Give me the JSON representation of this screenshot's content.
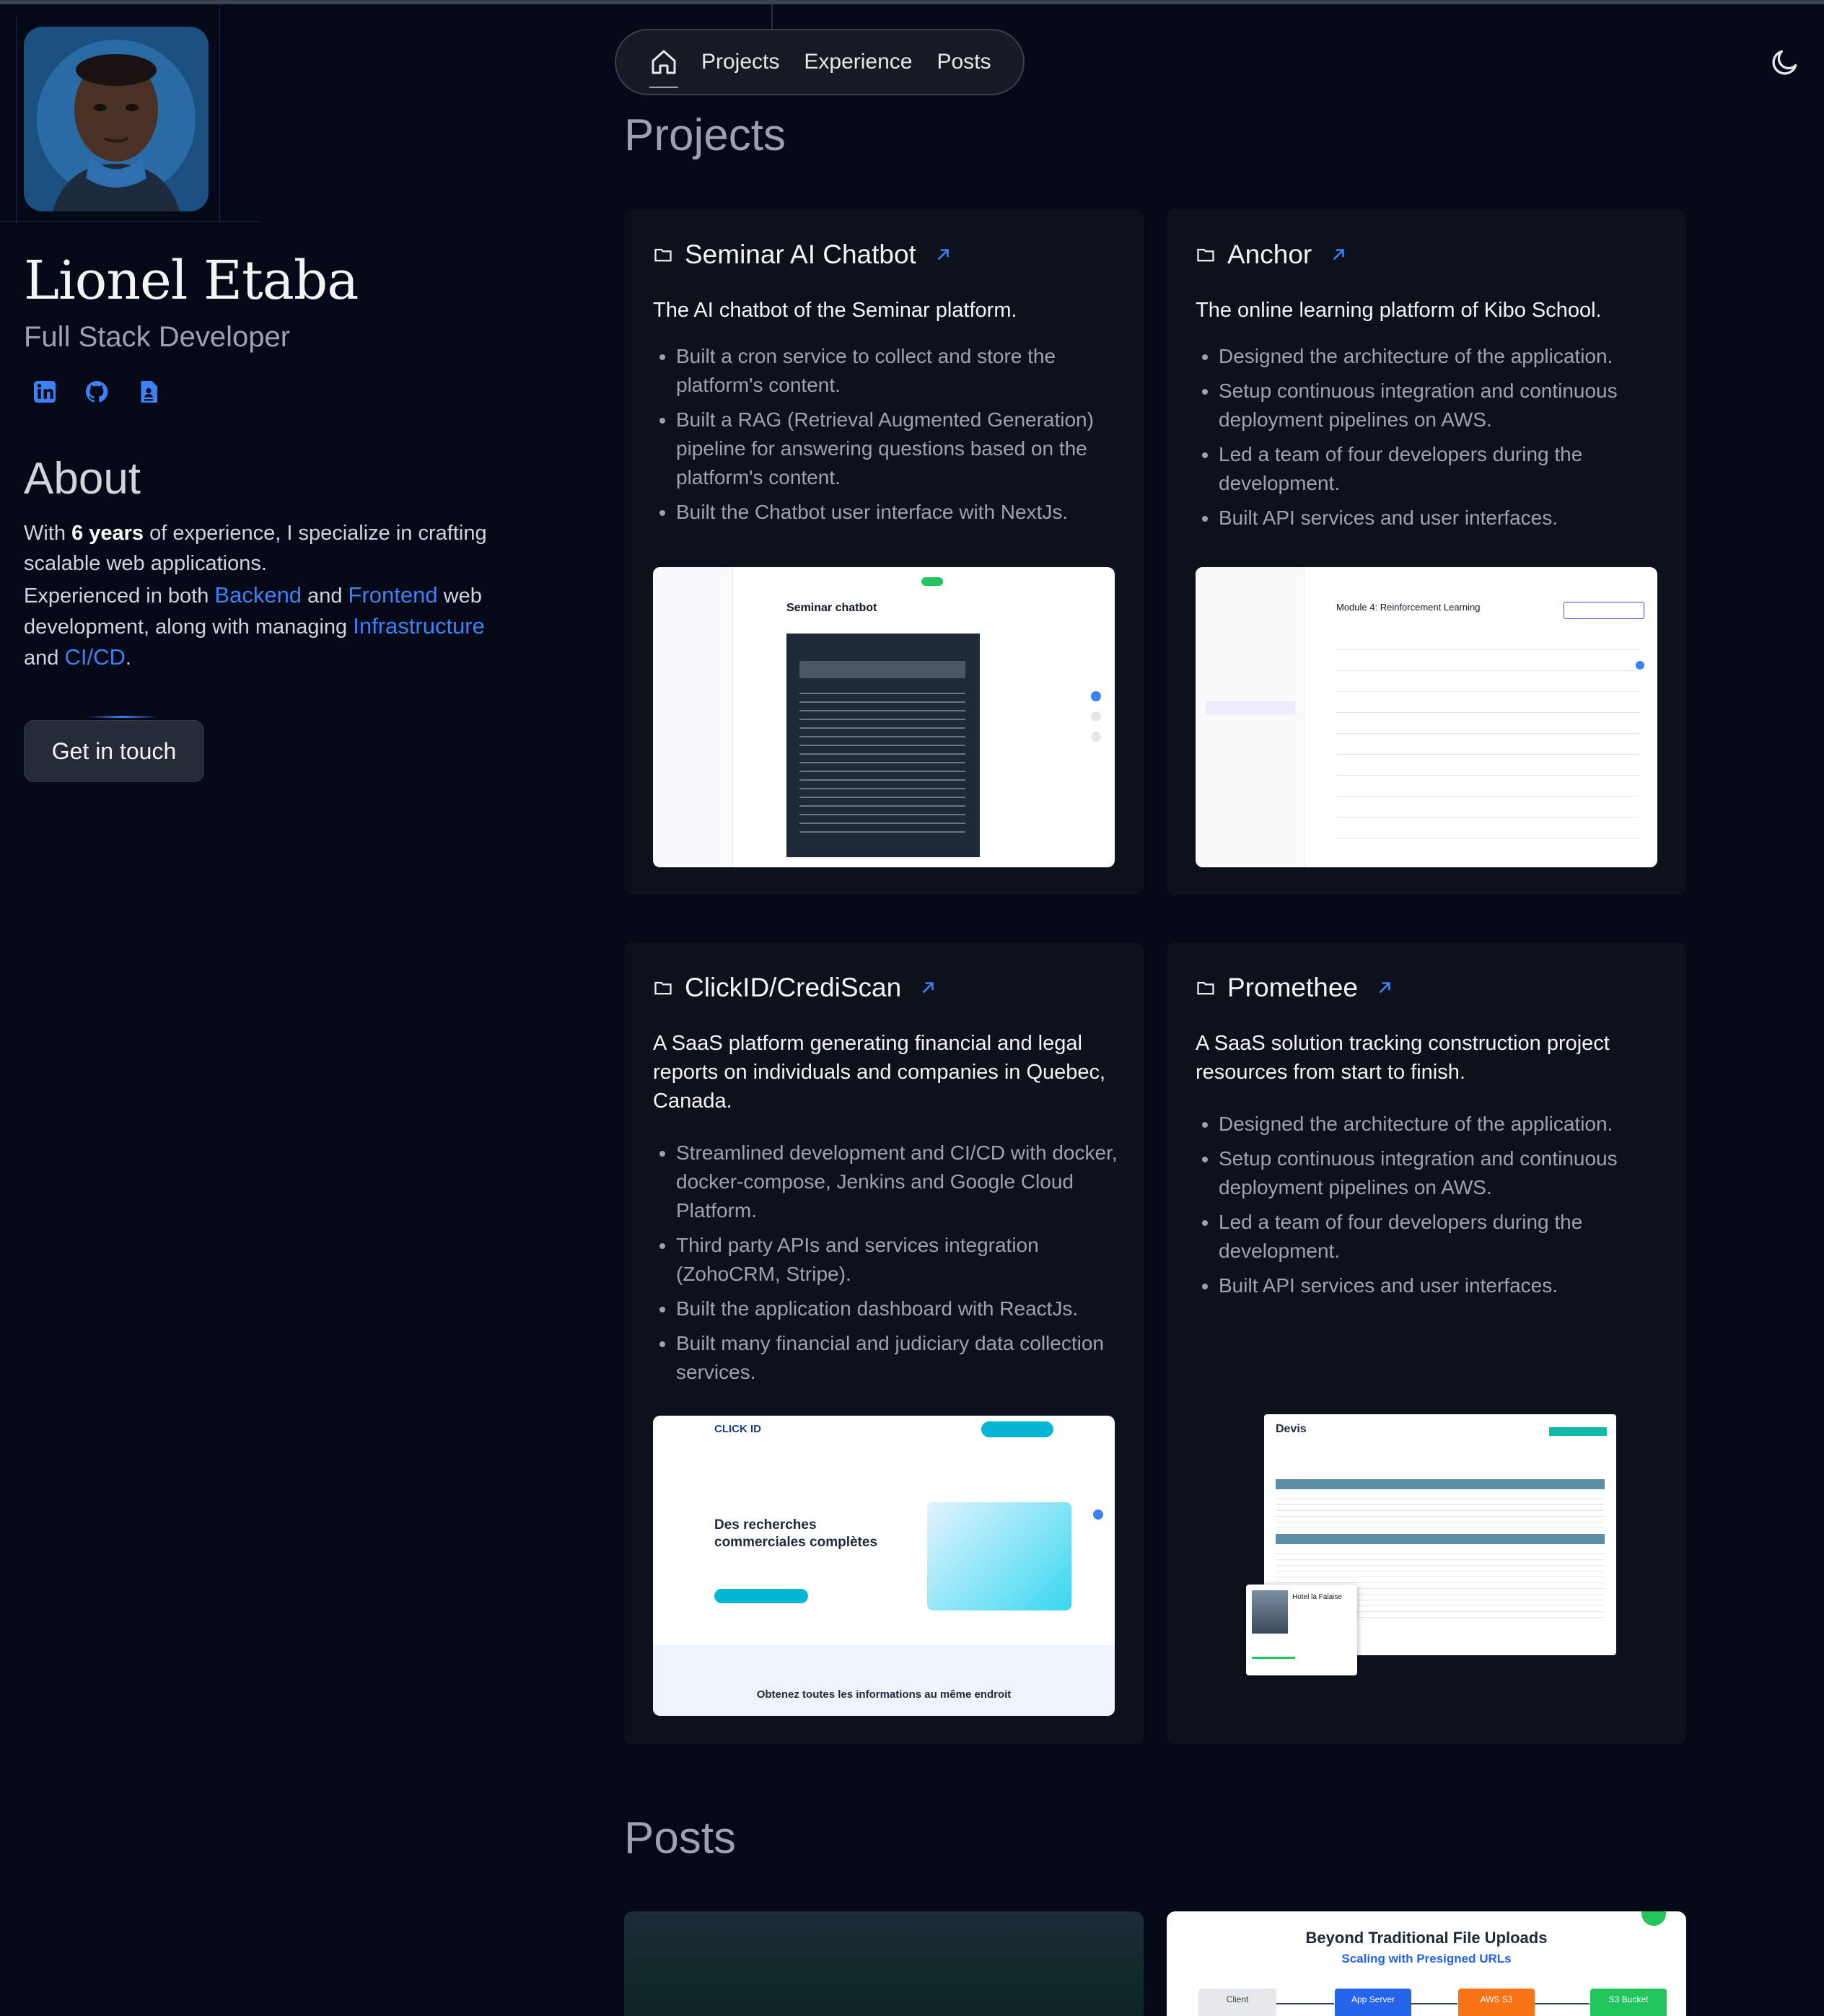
{
  "profile": {
    "name": "Lionel Etaba",
    "role": "Full Stack Developer",
    "socials": [
      {
        "icon": "linkedin-icon"
      },
      {
        "icon": "github-icon"
      },
      {
        "icon": "resume-icon"
      }
    ]
  },
  "about": {
    "heading": "About",
    "p1_prefix": "With ",
    "p1_bold": "6 years",
    "p1_suffix": " of experience, I specialize in crafting scalable web applications.",
    "p2_a": "Experienced in both ",
    "backend": "Backend",
    "p2_and1": " and ",
    "frontend": "Frontend",
    "p2_b": " web development, along with managing ",
    "infrastructure": "Infrastructure",
    "p2_and2": " and ",
    "cicd": "CI/CD",
    "p2_end": "."
  },
  "cta": {
    "label": "Get in touch"
  },
  "nav": {
    "items": [
      "Projects",
      "Experience",
      "Posts"
    ]
  },
  "theme_toggle_icon": "moon-icon",
  "sections": {
    "projects": "Projects",
    "posts": "Posts"
  },
  "projects": [
    {
      "title": "Seminar AI Chatbot",
      "description": "The AI chatbot of the Seminar platform.",
      "bullets": [
        "Built a cron service to collect and store the platform's content.",
        "Built a RAG (Retrieval Augmented Generation) pipeline for answering questions based on the platform's content.",
        "Built the Chatbot user interface with NextJs."
      ],
      "screenshot_title": "Seminar chatbot"
    },
    {
      "title": "Anchor",
      "description": "The online learning platform of Kibo School.",
      "bullets": [
        "Designed the architecture of the application.",
        "Setup continuous integration and continuous deployment pipelines on AWS.",
        "Led a team of four developers during the development.",
        "Built API services and user interfaces."
      ],
      "screenshot_title": "Module 4: Reinforcement Learning"
    },
    {
      "title": "ClickID/CrediScan",
      "description": "A SaaS platform generating financial and legal reports on individuals and companies in Quebec, Canada.",
      "bullets": [
        "Streamlined development and CI/CD with docker, docker-compose, Jenkins and Google Cloud Platform.",
        "Third party APIs and services integration (ZohoCRM, Stripe).",
        "Built the application dashboard with ReactJs.",
        "Built many financial and judiciary data collection services."
      ],
      "screenshot_logo": "CLICK ID",
      "screenshot_heading": "Des recherches commerciales complètes",
      "screenshot_footer": "Obtenez toutes les informations au même endroit"
    },
    {
      "title": "Promethee",
      "description": "A SaaS solution tracking construction project resources from start to finish.",
      "bullets": [
        "Designed the architecture of the application.",
        "Setup continuous integration and continuous deployment pipelines on AWS.",
        "Led a team of four developers during the development.",
        "Built API services and user interfaces."
      ],
      "screenshot_title": "Devis",
      "screenshot_card": "Hotel la Falaise"
    }
  ],
  "posts": [
    {
      "title": ""
    },
    {
      "title": "Beyond Traditional File Uploads",
      "subtitle": "Scaling with Presigned URLs",
      "diagram": [
        "Client",
        "App Server",
        "AWS S3",
        "S3 Bucket"
      ]
    }
  ],
  "colors": {
    "background": "#050816",
    "card": "#0d111c",
    "accent": "#3b82f6"
  }
}
